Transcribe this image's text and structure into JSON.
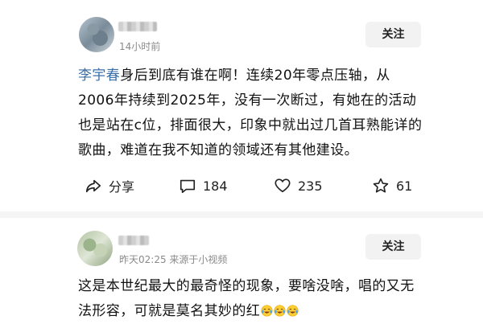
{
  "posts": [
    {
      "time": "14小时前",
      "follow_label": "关注",
      "mention": "李宇春",
      "body": "身后到底有谁在啊！连续20年零点压轴，从2006年持续到2025年，没有一次断过，有她在的活动也是站在c位，排面很大，印象中就出过几首耳熟能详的歌曲，难道在我不知道的领域还有其他建设。",
      "actions": {
        "share_label": "分享",
        "comments": "184",
        "likes": "235",
        "favorites": "61"
      }
    },
    {
      "time": "昨天02:25  来源于小视频",
      "follow_label": "关注",
      "body": "这是本世纪最大的最奇怪的现象，要啥没啥，唱的又无法形容，可就是莫名其妙的红",
      "emoji_icon": "crying-laughing-emoji",
      "emoji_count": 3
    }
  ],
  "colors": {
    "mention": "#3a6ea8",
    "follow_bg": "#f2f2f2",
    "meta": "#8a8a8a"
  }
}
